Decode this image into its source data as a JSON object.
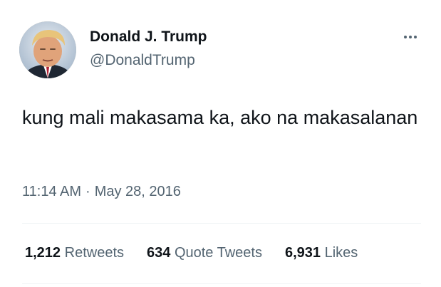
{
  "author": {
    "name": "Donald J. Trump",
    "handle": "@DonaldTrump"
  },
  "tweet": {
    "text": "kung mali makasama ka, ako na makasalanan",
    "time": "11:14 AM",
    "separator": "·",
    "date": "May 28, 2016"
  },
  "stats": {
    "retweets_count": "1,212",
    "retweets_label": "Retweets",
    "quotes_count": "634",
    "quotes_label": "Quote Tweets",
    "likes_count": "6,931",
    "likes_label": "Likes"
  },
  "icons": {
    "more": "more-horizontal-icon"
  },
  "colors": {
    "primary_text": "#0f1419",
    "secondary_text": "#536471",
    "divider": "#eff3f4"
  }
}
